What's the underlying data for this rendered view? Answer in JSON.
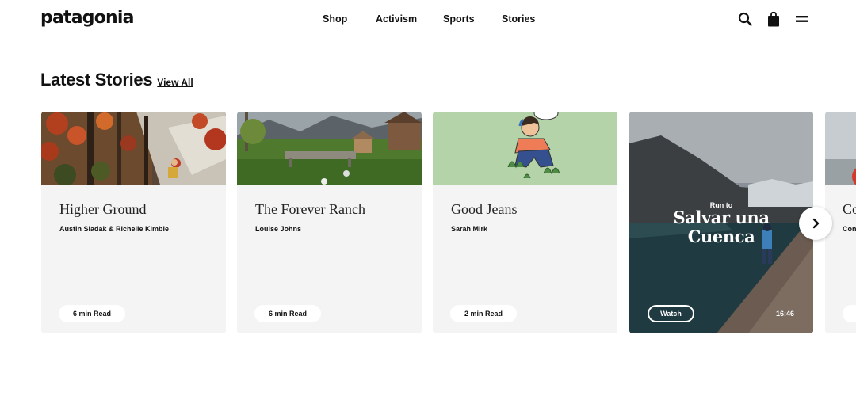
{
  "header": {
    "logo": "patagonia",
    "nav": [
      "Shop",
      "Activism",
      "Sports",
      "Stories"
    ],
    "icons": [
      "search-icon",
      "shopping-bag-icon",
      "menu-icon"
    ]
  },
  "section": {
    "title": "Latest Stories",
    "view_all": "View All"
  },
  "cards": [
    {
      "title": "Higher Ground",
      "author": "Austin Siadak & Richelle Kimble",
      "read": "6 min Read"
    },
    {
      "title": "The Forever Ranch",
      "author": "Louise Johns",
      "read": "6 min Read"
    },
    {
      "title": "Good Jeans",
      "author": "Sarah Mirk",
      "read": "2 min Read"
    }
  ],
  "video": {
    "kicker": "Run to",
    "title_line1": "Salvar una",
    "title_line2": "Cuenca",
    "watch": "Watch",
    "duration": "16:46"
  },
  "partial_card": {
    "title": "Co",
    "author": "Con"
  },
  "colors": {
    "card_bg": "#f4f4f4",
    "text": "#111111",
    "illustration_bg": "#b5d3a8"
  }
}
